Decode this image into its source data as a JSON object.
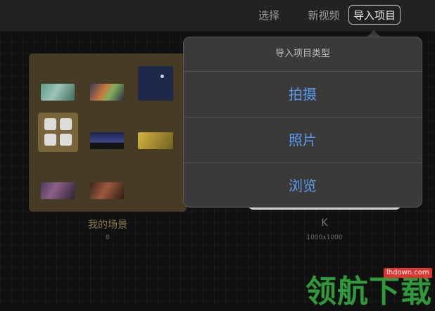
{
  "toolbar": {
    "select_label": "选择",
    "new_video_label": "新视频",
    "import_label": "导入项目"
  },
  "projects": [
    {
      "title": "我的场景",
      "count": "8"
    },
    {
      "title": "K",
      "resolution": "1000x1000"
    }
  ],
  "import_popover": {
    "title": "导入项目类型",
    "options": [
      "拍摄",
      "照片",
      "浏览"
    ]
  },
  "watermark": {
    "text": "领航下载",
    "url": "lhdown.com"
  },
  "colors": {
    "accent_blue": "#5b9bf0",
    "folder_bg": "#463c25",
    "watermark_green": "#2f9a3a"
  }
}
